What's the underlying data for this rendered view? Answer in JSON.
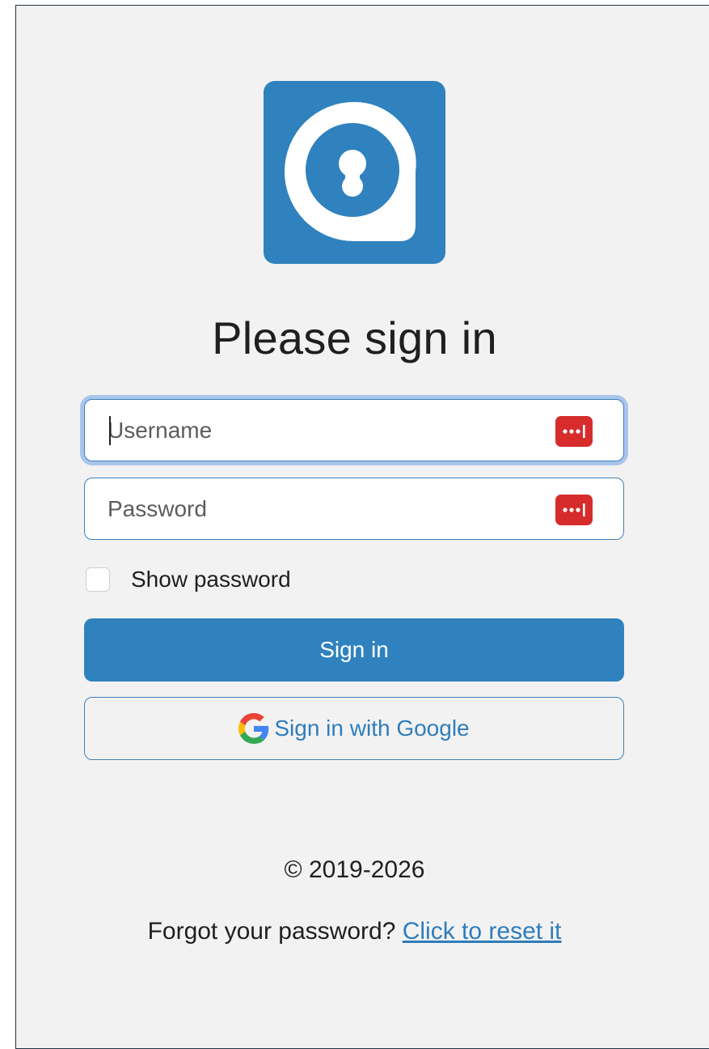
{
  "title": "Please sign in",
  "username_field": {
    "placeholder": "Username",
    "value": ""
  },
  "password_field": {
    "placeholder": "Password",
    "value": ""
  },
  "show_password": {
    "label": "Show password",
    "checked": false
  },
  "sign_in_button": {
    "label": "Sign in"
  },
  "google_button": {
    "label": "Sign in with Google",
    "icon": "google-g-icon"
  },
  "footer": {
    "copyright": "© 2019-2026",
    "forgot_prompt": "Forgot your password?",
    "reset_link": "Click to reset it"
  },
  "icons": {
    "logo": "lock-keyhole-logo",
    "field_addon": "password-manager-icon"
  },
  "colors": {
    "brand": "#2f82be",
    "password_manager": "#d62c2c",
    "focus_ring": "#92b6e8",
    "background": "#f2f2f2"
  }
}
